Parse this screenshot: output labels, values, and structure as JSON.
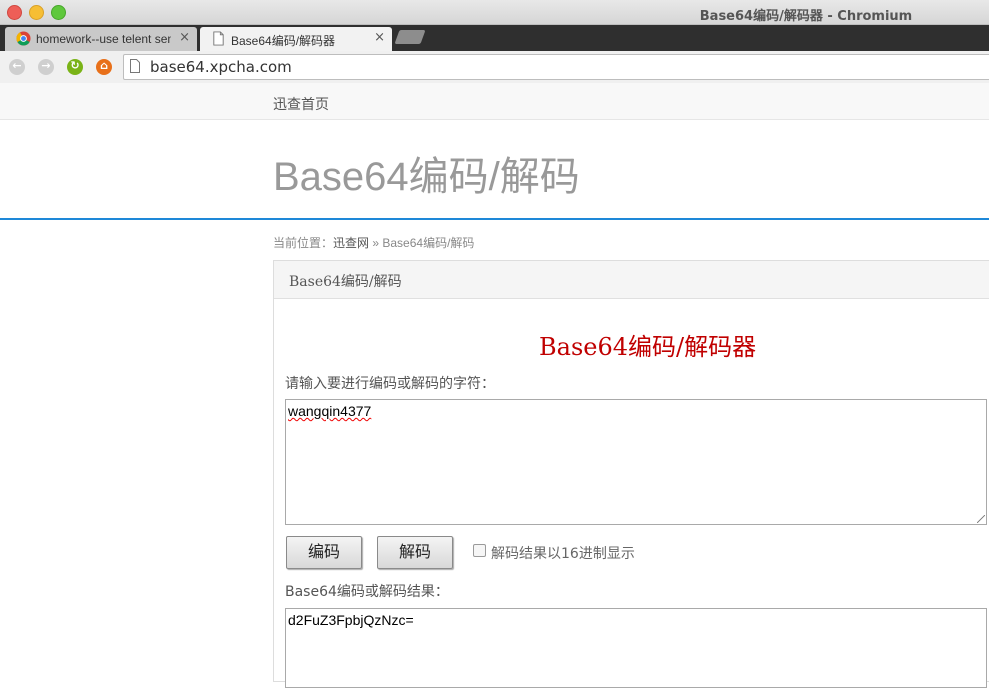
{
  "window": {
    "title": "Base64编码/解码器 - Chromium"
  },
  "tabs": [
    {
      "label": "homework--use telent sen",
      "close": "×"
    },
    {
      "label": "Base64编码/解码器",
      "close": "×"
    }
  ],
  "address_bar": {
    "url": "base64.xpcha.com"
  },
  "site_nav": {
    "home": "迅查首页"
  },
  "header": {
    "title": "Base64编码/解码"
  },
  "breadcrumb": {
    "prefix": "当前位置：",
    "site": "迅查网",
    "separator": " » ",
    "current": "Base64编码/解码"
  },
  "panel": {
    "heading": "Base64编码/解码",
    "tool_title": "Base64编码/解码器",
    "input_prompt": "请输入要进行编码或解码的字符：",
    "input_value": "wangqin4377",
    "encode_button": "编码",
    "decode_button": "解码",
    "hex_checkbox_label": "解码结果以16进制显示",
    "hex_checked": false,
    "result_label": "Base64编码或解码结果：",
    "result_value": "d2FuZ3FpbjQzNzc="
  },
  "colors": {
    "accent_rule": "#1e88d8",
    "tool_title": "#c00000"
  }
}
